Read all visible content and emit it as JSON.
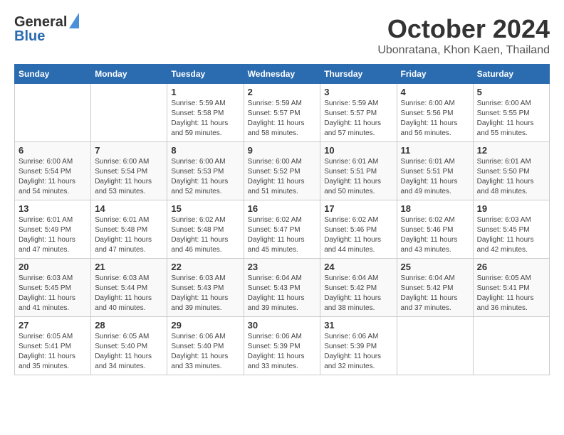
{
  "header": {
    "logo_general": "General",
    "logo_blue": "Blue",
    "month": "October 2024",
    "location": "Ubonratana, Khon Kaen, Thailand"
  },
  "calendar": {
    "days_of_week": [
      "Sunday",
      "Monday",
      "Tuesday",
      "Wednesday",
      "Thursday",
      "Friday",
      "Saturday"
    ],
    "weeks": [
      [
        {
          "day": "",
          "sunrise": "",
          "sunset": "",
          "daylight": ""
        },
        {
          "day": "",
          "sunrise": "",
          "sunset": "",
          "daylight": ""
        },
        {
          "day": "1",
          "sunrise": "Sunrise: 5:59 AM",
          "sunset": "Sunset: 5:58 PM",
          "daylight": "Daylight: 11 hours and 59 minutes."
        },
        {
          "day": "2",
          "sunrise": "Sunrise: 5:59 AM",
          "sunset": "Sunset: 5:57 PM",
          "daylight": "Daylight: 11 hours and 58 minutes."
        },
        {
          "day": "3",
          "sunrise": "Sunrise: 5:59 AM",
          "sunset": "Sunset: 5:57 PM",
          "daylight": "Daylight: 11 hours and 57 minutes."
        },
        {
          "day": "4",
          "sunrise": "Sunrise: 6:00 AM",
          "sunset": "Sunset: 5:56 PM",
          "daylight": "Daylight: 11 hours and 56 minutes."
        },
        {
          "day": "5",
          "sunrise": "Sunrise: 6:00 AM",
          "sunset": "Sunset: 5:55 PM",
          "daylight": "Daylight: 11 hours and 55 minutes."
        }
      ],
      [
        {
          "day": "6",
          "sunrise": "Sunrise: 6:00 AM",
          "sunset": "Sunset: 5:54 PM",
          "daylight": "Daylight: 11 hours and 54 minutes."
        },
        {
          "day": "7",
          "sunrise": "Sunrise: 6:00 AM",
          "sunset": "Sunset: 5:54 PM",
          "daylight": "Daylight: 11 hours and 53 minutes."
        },
        {
          "day": "8",
          "sunrise": "Sunrise: 6:00 AM",
          "sunset": "Sunset: 5:53 PM",
          "daylight": "Daylight: 11 hours and 52 minutes."
        },
        {
          "day": "9",
          "sunrise": "Sunrise: 6:00 AM",
          "sunset": "Sunset: 5:52 PM",
          "daylight": "Daylight: 11 hours and 51 minutes."
        },
        {
          "day": "10",
          "sunrise": "Sunrise: 6:01 AM",
          "sunset": "Sunset: 5:51 PM",
          "daylight": "Daylight: 11 hours and 50 minutes."
        },
        {
          "day": "11",
          "sunrise": "Sunrise: 6:01 AM",
          "sunset": "Sunset: 5:51 PM",
          "daylight": "Daylight: 11 hours and 49 minutes."
        },
        {
          "day": "12",
          "sunrise": "Sunrise: 6:01 AM",
          "sunset": "Sunset: 5:50 PM",
          "daylight": "Daylight: 11 hours and 48 minutes."
        }
      ],
      [
        {
          "day": "13",
          "sunrise": "Sunrise: 6:01 AM",
          "sunset": "Sunset: 5:49 PM",
          "daylight": "Daylight: 11 hours and 47 minutes."
        },
        {
          "day": "14",
          "sunrise": "Sunrise: 6:01 AM",
          "sunset": "Sunset: 5:48 PM",
          "daylight": "Daylight: 11 hours and 47 minutes."
        },
        {
          "day": "15",
          "sunrise": "Sunrise: 6:02 AM",
          "sunset": "Sunset: 5:48 PM",
          "daylight": "Daylight: 11 hours and 46 minutes."
        },
        {
          "day": "16",
          "sunrise": "Sunrise: 6:02 AM",
          "sunset": "Sunset: 5:47 PM",
          "daylight": "Daylight: 11 hours and 45 minutes."
        },
        {
          "day": "17",
          "sunrise": "Sunrise: 6:02 AM",
          "sunset": "Sunset: 5:46 PM",
          "daylight": "Daylight: 11 hours and 44 minutes."
        },
        {
          "day": "18",
          "sunrise": "Sunrise: 6:02 AM",
          "sunset": "Sunset: 5:46 PM",
          "daylight": "Daylight: 11 hours and 43 minutes."
        },
        {
          "day": "19",
          "sunrise": "Sunrise: 6:03 AM",
          "sunset": "Sunset: 5:45 PM",
          "daylight": "Daylight: 11 hours and 42 minutes."
        }
      ],
      [
        {
          "day": "20",
          "sunrise": "Sunrise: 6:03 AM",
          "sunset": "Sunset: 5:45 PM",
          "daylight": "Daylight: 11 hours and 41 minutes."
        },
        {
          "day": "21",
          "sunrise": "Sunrise: 6:03 AM",
          "sunset": "Sunset: 5:44 PM",
          "daylight": "Daylight: 11 hours and 40 minutes."
        },
        {
          "day": "22",
          "sunrise": "Sunrise: 6:03 AM",
          "sunset": "Sunset: 5:43 PM",
          "daylight": "Daylight: 11 hours and 39 minutes."
        },
        {
          "day": "23",
          "sunrise": "Sunrise: 6:04 AM",
          "sunset": "Sunset: 5:43 PM",
          "daylight": "Daylight: 11 hours and 39 minutes."
        },
        {
          "day": "24",
          "sunrise": "Sunrise: 6:04 AM",
          "sunset": "Sunset: 5:42 PM",
          "daylight": "Daylight: 11 hours and 38 minutes."
        },
        {
          "day": "25",
          "sunrise": "Sunrise: 6:04 AM",
          "sunset": "Sunset: 5:42 PM",
          "daylight": "Daylight: 11 hours and 37 minutes."
        },
        {
          "day": "26",
          "sunrise": "Sunrise: 6:05 AM",
          "sunset": "Sunset: 5:41 PM",
          "daylight": "Daylight: 11 hours and 36 minutes."
        }
      ],
      [
        {
          "day": "27",
          "sunrise": "Sunrise: 6:05 AM",
          "sunset": "Sunset: 5:41 PM",
          "daylight": "Daylight: 11 hours and 35 minutes."
        },
        {
          "day": "28",
          "sunrise": "Sunrise: 6:05 AM",
          "sunset": "Sunset: 5:40 PM",
          "daylight": "Daylight: 11 hours and 34 minutes."
        },
        {
          "day": "29",
          "sunrise": "Sunrise: 6:06 AM",
          "sunset": "Sunset: 5:40 PM",
          "daylight": "Daylight: 11 hours and 33 minutes."
        },
        {
          "day": "30",
          "sunrise": "Sunrise: 6:06 AM",
          "sunset": "Sunset: 5:39 PM",
          "daylight": "Daylight: 11 hours and 33 minutes."
        },
        {
          "day": "31",
          "sunrise": "Sunrise: 6:06 AM",
          "sunset": "Sunset: 5:39 PM",
          "daylight": "Daylight: 11 hours and 32 minutes."
        },
        {
          "day": "",
          "sunrise": "",
          "sunset": "",
          "daylight": ""
        },
        {
          "day": "",
          "sunrise": "",
          "sunset": "",
          "daylight": ""
        }
      ]
    ]
  }
}
